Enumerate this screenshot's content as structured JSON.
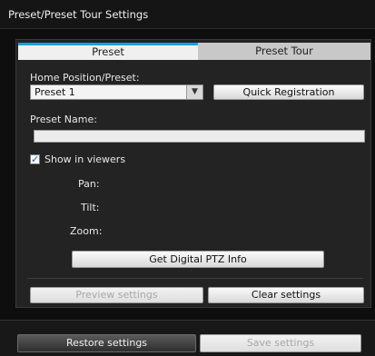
{
  "window": {
    "title": "Preset/Preset Tour Settings"
  },
  "tabs": [
    {
      "label": "Preset",
      "active": true
    },
    {
      "label": "Preset Tour",
      "active": false
    }
  ],
  "form": {
    "home_label": "Home Position/Preset:",
    "preset_select_value": "Preset 1",
    "quick_registration_label": "Quick Registration",
    "preset_name_label": "Preset Name:",
    "preset_name_value": "",
    "show_in_viewers_label": "Show in viewers",
    "show_in_viewers_checked": true,
    "pan_label": "Pan:",
    "tilt_label": "Tilt:",
    "zoom_label": "Zoom:",
    "get_ptz_label": "Get Digital PTZ Info",
    "preview_label": "Preview settings",
    "clear_label": "Clear settings"
  },
  "footer": {
    "restore_label": "Restore settings",
    "save_label": "Save settings"
  },
  "colors": {
    "accent": "#1aa0d8",
    "background": "#0e0e0e",
    "panel": "#232323"
  },
  "icons": {
    "select_arrow": "chevron-down-icon",
    "checkbox": "checkmark-icon"
  }
}
